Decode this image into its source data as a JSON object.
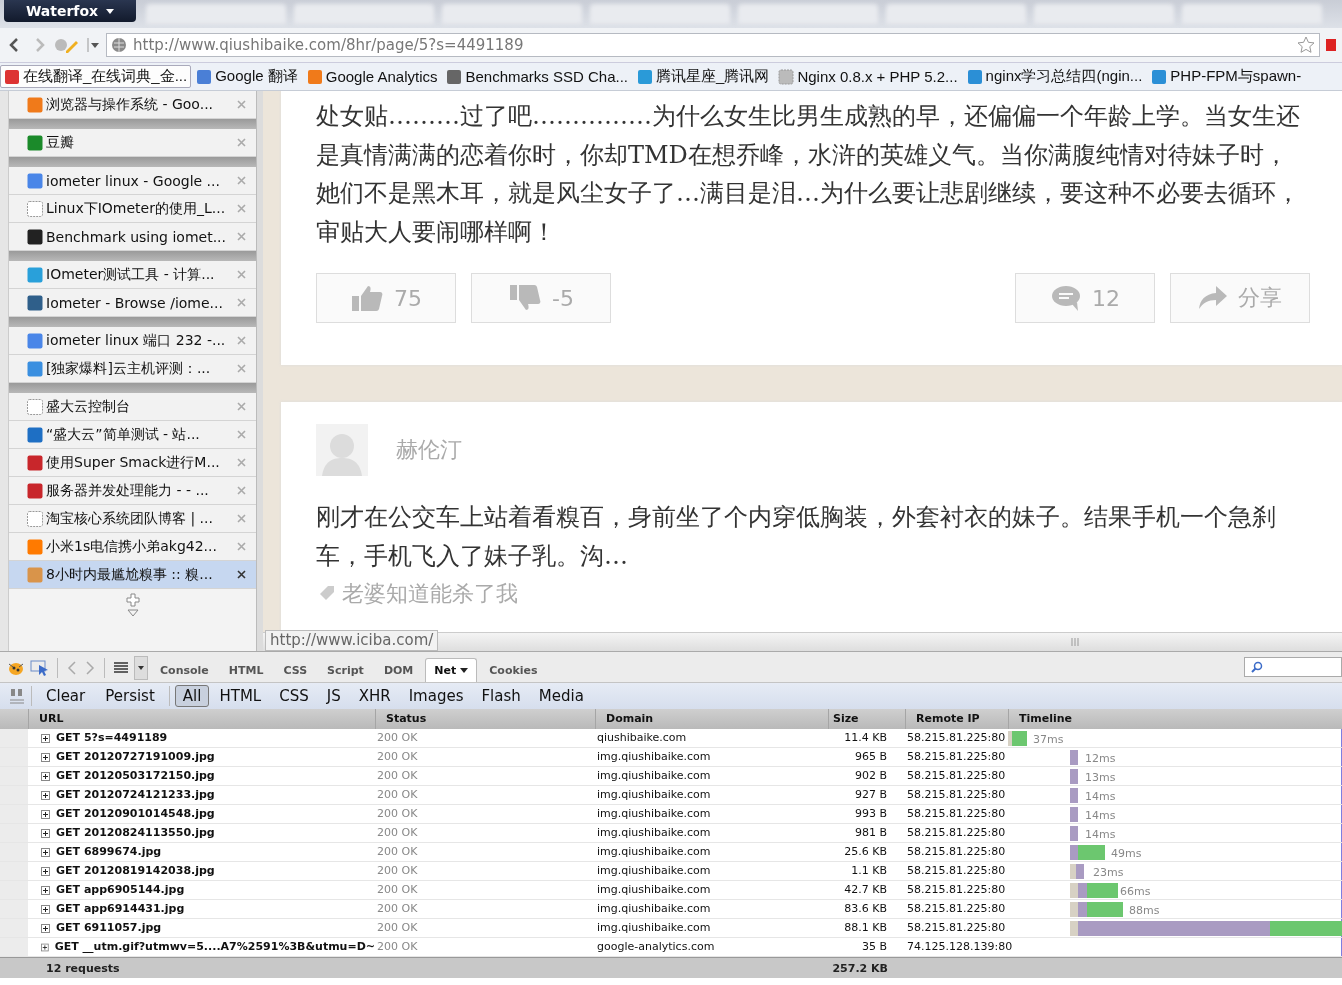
{
  "browser": {
    "app_button": "Waterfox",
    "address": "http://www.qiushibaike.com/8hr/page/5?s=4491189"
  },
  "bookmarks": [
    {
      "label": "在线翻译_在线词典_金...",
      "selected": true
    },
    {
      "label": "Google 翻译",
      "selected": false
    },
    {
      "label": "Google Analytics",
      "selected": false
    },
    {
      "label": "Benchmarks SSD Cha...",
      "selected": false
    },
    {
      "label": "腾讯星座_腾讯网",
      "selected": false
    },
    {
      "label": "Nginx 0.8.x + PHP 5.2...",
      "selected": false
    },
    {
      "label": "nginx学习总结四(ngin...",
      "selected": false
    },
    {
      "label": "PHP-FPM与spawn-",
      "selected": false
    }
  ],
  "sidebar": {
    "groups": [
      {
        "items": [
          {
            "label": "浏览器与操作系统 - Goo...",
            "selected": false
          }
        ]
      },
      {
        "items": [
          {
            "label": "豆瓣",
            "selected": false
          }
        ]
      },
      {
        "items": [
          {
            "label": "iometer linux - Google ...",
            "selected": false
          },
          {
            "label": "Linux下IOmeter的使用_L...",
            "selected": false
          },
          {
            "label": "Benchmark using iomet...",
            "selected": false
          }
        ]
      },
      {
        "items": [
          {
            "label": "IOmeter测试工具 - 计算...",
            "selected": false
          },
          {
            "label": "Iometer - Browse /iome...",
            "selected": false
          }
        ]
      },
      {
        "items": [
          {
            "label": "iometer linux 端口 232 -...",
            "selected": false
          },
          {
            "label": "[独家爆料]云主机评测：...",
            "selected": false
          }
        ]
      },
      {
        "items": [
          {
            "label": "盛大云控制台",
            "selected": false
          },
          {
            "label": "“盛大云”简单测试 - 站...",
            "selected": false
          },
          {
            "label": "使用Super Smack进行M...",
            "selected": false
          },
          {
            "label": "服务器并发处理能力 - - ...",
            "selected": false
          },
          {
            "label": "淘宝核心系统团队博客 | ...",
            "selected": false
          },
          {
            "label": "小米1s电信携小弟akg42...",
            "selected": false
          },
          {
            "label": "8小时内最尴尬糗事 :: 糗...",
            "selected": true
          }
        ]
      }
    ]
  },
  "posts": [
    {
      "text": "处女贴………过了吧……………为什么女生比男生成熟的早，还偏偏一个年龄上学。当女生还是真情满满的恋着你时，你却TMD在想乔峰，水浒的英雄义气。当你满腹纯情对待妹子时，她们不是黑木耳，就是风尘女子了…满目是泪…为什么要让悲剧继续，要这种不必要去循环，审贴大人要闹哪样啊！",
      "actions": [
        {
          "kind": "up",
          "label": "75"
        },
        {
          "kind": "down",
          "label": "-5"
        },
        {
          "kind": "comment",
          "label": "12"
        },
        {
          "kind": "share",
          "label": "分享"
        }
      ]
    },
    {
      "author": "赫伦汀",
      "text": "刚才在公交车上站着看糗百，身前坐了个内穿低胸装，外套衬衣的妹子。结果手机一个急刹车，手机飞入了妹子乳。沟…",
      "tag": "老婆知道能杀了我"
    }
  ],
  "status_url": "http://www.iciba.com/",
  "devtools": {
    "tabs": [
      {
        "label": "Console",
        "selected": false
      },
      {
        "label": "HTML",
        "selected": false
      },
      {
        "label": "CSS",
        "selected": false
      },
      {
        "label": "Script",
        "selected": false
      },
      {
        "label": "DOM",
        "selected": false
      },
      {
        "label": "Net",
        "selected": true
      },
      {
        "label": "Cookies",
        "selected": false
      }
    ],
    "filters": [
      {
        "label": "Clear",
        "kind": "action",
        "selected": false
      },
      {
        "label": "Persist",
        "kind": "action",
        "selected": false
      },
      {
        "label": "All",
        "kind": "filter",
        "selected": true
      },
      {
        "label": "HTML",
        "kind": "filter",
        "selected": false
      },
      {
        "label": "CSS",
        "kind": "filter",
        "selected": false
      },
      {
        "label": "JS",
        "kind": "filter",
        "selected": false
      },
      {
        "label": "XHR",
        "kind": "filter",
        "selected": false
      },
      {
        "label": "Images",
        "kind": "filter",
        "selected": false
      },
      {
        "label": "Flash",
        "kind": "filter",
        "selected": false
      },
      {
        "label": "Media",
        "kind": "filter",
        "selected": false
      }
    ],
    "columns": [
      "URL",
      "Status",
      "Domain",
      "Size",
      "Remote IP",
      "Timeline"
    ],
    "rows": [
      {
        "url": "GET 5?s=4491189",
        "status": "200 OK",
        "domain": "qiushibaike.com",
        "size": "11.4 KB",
        "ip": "58.215.81.225:80",
        "time": "37ms"
      },
      {
        "url": "GET 20120727191009.jpg",
        "status": "200 OK",
        "domain": "img.qiushibaike.com",
        "size": "965 B",
        "ip": "58.215.81.225:80",
        "time": "12ms"
      },
      {
        "url": "GET 20120503172150.jpg",
        "status": "200 OK",
        "domain": "img.qiushibaike.com",
        "size": "902 B",
        "ip": "58.215.81.225:80",
        "time": "13ms"
      },
      {
        "url": "GET 20120724121233.jpg",
        "status": "200 OK",
        "domain": "img.qiushibaike.com",
        "size": "927 B",
        "ip": "58.215.81.225:80",
        "time": "14ms"
      },
      {
        "url": "GET 20120901014548.jpg",
        "status": "200 OK",
        "domain": "img.qiushibaike.com",
        "size": "993 B",
        "ip": "58.215.81.225:80",
        "time": "14ms"
      },
      {
        "url": "GET 20120824113550.jpg",
        "status": "200 OK",
        "domain": "img.qiushibaike.com",
        "size": "981 B",
        "ip": "58.215.81.225:80",
        "time": "14ms"
      },
      {
        "url": "GET 6899674.jpg",
        "status": "200 OK",
        "domain": "img.qiushibaike.com",
        "size": "25.6 KB",
        "ip": "58.215.81.225:80",
        "time": "49ms"
      },
      {
        "url": "GET 20120819142038.jpg",
        "status": "200 OK",
        "domain": "img.qiushibaike.com",
        "size": "1.1 KB",
        "ip": "58.215.81.225:80",
        "time": "23ms"
      },
      {
        "url": "GET app6905144.jpg",
        "status": "200 OK",
        "domain": "img.qiushibaike.com",
        "size": "42.7 KB",
        "ip": "58.215.81.225:80",
        "time": "66ms"
      },
      {
        "url": "GET app6914431.jpg",
        "status": "200 OK",
        "domain": "img.qiushibaike.com",
        "size": "83.6 KB",
        "ip": "58.215.81.225:80",
        "time": "88ms"
      },
      {
        "url": "GET 6911057.jpg",
        "status": "200 OK",
        "domain": "img.qiushibaike.com",
        "size": "88.1 KB",
        "ip": "58.215.81.225:80"
      },
      {
        "url": "GET __utm.gif?utmwv=5....A7%2591%3B&utmu=D~",
        "status": "200 OK",
        "domain": "google-analytics.com",
        "size": "35 B",
        "ip": "74.125.128.139:80"
      }
    ],
    "summary": {
      "requests": "12 requests",
      "total_size": "257.2 KB"
    }
  }
}
